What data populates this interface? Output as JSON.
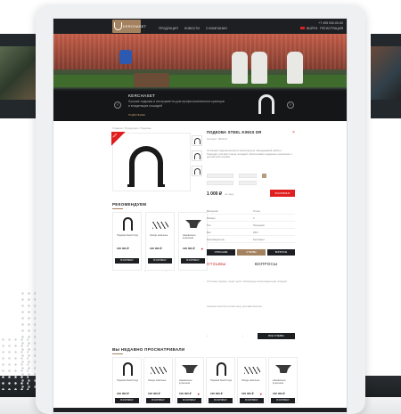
{
  "header": {
    "logo_text": "KERCHASET",
    "nav": [
      "ПРОДУКЦИЯ",
      "НОВОСТИ",
      "О КОМПАНИИ"
    ],
    "top_right": [
      "+7 495 000-00-00",
      "ВОЙТИ · РЕГИСТРАЦИЯ"
    ]
  },
  "hero": {
    "title": "KERCHASET",
    "description": "Лучшие подковы и инструменты для профессиональных кузнецов и владельцев лошадей",
    "more": "ПОДРОБНЕЕ"
  },
  "breadcrumb": "Главная / Продукция / Подковы",
  "product": {
    "title": "ПОДКОВА STEEL KINGS DR",
    "subtitle": "Артикул: 000123",
    "badge": "NEW",
    "description": "Стальная подкова высокого качества для повседневной работы. Подходит для всех пород лошадей, обеспечивает надежное сцепление и долгий срок службы.",
    "price": "1 000 ₽",
    "price_note": "за пару",
    "buy_label": "В КОРЗИНУ"
  },
  "recommended": {
    "title": "РЕКОМЕНДУЕМ",
    "cards": [
      {
        "icon": "horseshoe-icon",
        "name": "Подкова Steel Kings",
        "price": "100 000 ₽",
        "button": "В КОРЗИНУ"
      },
      {
        "icon": "nails-icon",
        "name": "Гвозди ковочные",
        "price": "100 000 ₽",
        "button": "В КОРЗИНУ"
      },
      {
        "icon": "anvil-icon",
        "name": "Наковальня кузнечная",
        "price": "100 000 ₽",
        "button": "В КОРЗИНУ"
      }
    ]
  },
  "specs": [
    [
      "Материал",
      "Сталь"
    ],
    [
      "Размер",
      "3"
    ],
    [
      "Тип",
      "Передняя"
    ],
    [
      "Вес",
      "300 г"
    ],
    [
      "Производитель",
      "Kerchaset"
    ],
    [
      "Страна",
      "Россия"
    ]
  ],
  "tabs": [
    "ОПИСАНИЕ",
    "ОТЗЫВЫ",
    "ВОПРОСЫ"
  ],
  "reviews": {
    "title": "ОТЗЫВЫ",
    "questions_title": "ВОПРОСЫ",
    "text1": "Отличная подкова, служит долго. Рекомендую всем владельцам лошадей.",
    "text2": "Хорошее качество за свою цену, доставка быстрая.",
    "more_button": "ВСЕ ОТЗЫВЫ"
  },
  "recently": {
    "title": "ВЫ НЕДАВНО ПРОСМАТРИВАЛИ",
    "cards": [
      {
        "icon": "horseshoe-icon",
        "name": "Подкова Steel Kings",
        "price": "100 000 ₽",
        "button": "В КОРЗИНУ"
      },
      {
        "icon": "nails-icon",
        "name": "Гвозди ковочные",
        "price": "100 000 ₽",
        "button": "В КОРЗИНУ"
      },
      {
        "icon": "anvil-icon",
        "name": "Наковальня кузнечная",
        "price": "100 000 ₽",
        "button": "В КОРЗИНУ"
      },
      {
        "icon": "horseshoe-icon",
        "name": "Подкова Steel Kings",
        "price": "100 000 ₽",
        "button": "В КОРЗИНУ"
      },
      {
        "icon": "nails-icon",
        "name": "Гвозди ковочные",
        "price": "100 000 ₽",
        "button": "В КОРЗИНУ"
      },
      {
        "icon": "anvil-icon",
        "name": "Наковальня кузнечная",
        "price": "100 000 ₽",
        "button": "В КОРЗИНУ"
      }
    ]
  },
  "colors": {
    "accent": "#a4825f",
    "buy": "#e02020",
    "dark": "#1d1f22"
  }
}
